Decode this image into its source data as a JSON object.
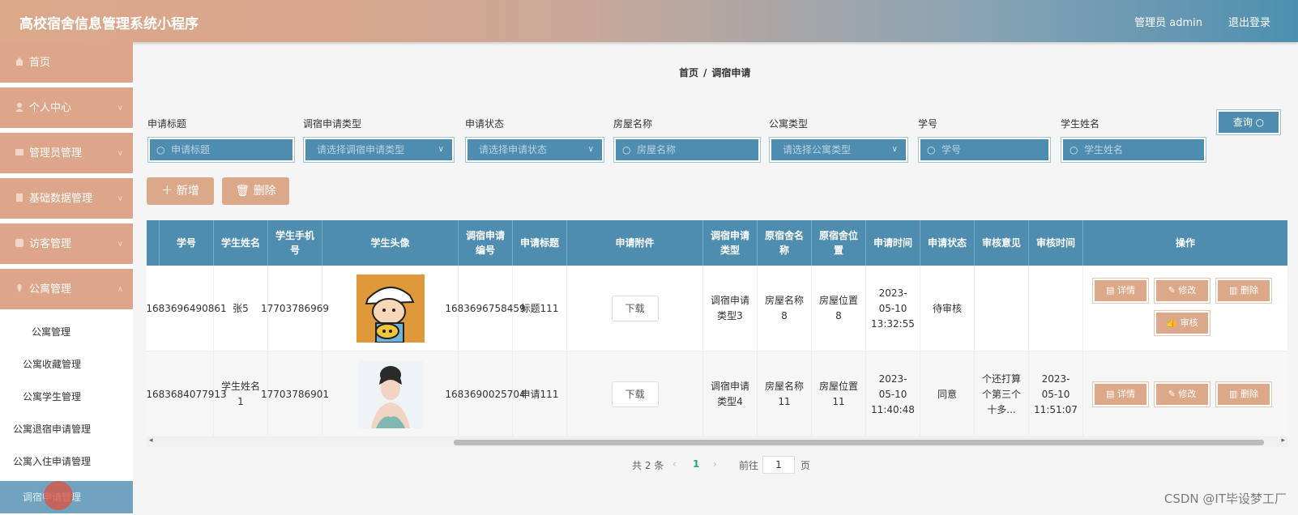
{
  "header": {
    "title": "高校宿舍信息管理系统小程序",
    "admin": "管理员 admin",
    "logout": "退出登录"
  },
  "sidebar": {
    "items": [
      {
        "label": "首页"
      },
      {
        "label": "个人中心"
      },
      {
        "label": "管理员管理"
      },
      {
        "label": "基础数据管理"
      },
      {
        "label": "访客管理"
      },
      {
        "label": "公寓管理"
      }
    ],
    "subitems": [
      {
        "label": "公寓管理"
      },
      {
        "label": "公寓收藏管理"
      },
      {
        "label": "公寓学生管理"
      },
      {
        "label": "公寓退宿申请管理"
      },
      {
        "label": "公寓入住申请管理"
      },
      {
        "label": "调宿申请管理"
      }
    ]
  },
  "breadcrumb": {
    "home": "首页",
    "sep": "/",
    "current": "调宿申请"
  },
  "filters": [
    {
      "label": "申请标题",
      "placeholder": "申请标题"
    },
    {
      "label": "调宿申请类型",
      "placeholder": "请选择调宿申请类型"
    },
    {
      "label": "申请状态",
      "placeholder": "请选择申请状态"
    },
    {
      "label": "房屋名称",
      "placeholder": "房屋名称"
    },
    {
      "label": "公寓类型",
      "placeholder": "请选择公寓类型"
    },
    {
      "label": "学号",
      "placeholder": "学号"
    },
    {
      "label": "学生姓名",
      "placeholder": "学生姓名"
    }
  ],
  "query_label": "查询",
  "actions": {
    "add": "新增",
    "delete": "删除"
  },
  "table": {
    "headers": [
      "学号",
      "学生姓名",
      "学生手机号",
      "学生头像",
      "调宿申请编号",
      "申请标题",
      "申请附件",
      "调宿申请类型",
      "原宿舍名称",
      "原宿舍位置",
      "申请时间",
      "申请状态",
      "审核意见",
      "审核时间",
      "操作"
    ],
    "rows": [
      {
        "id": "1683696490861",
        "name": "张5",
        "phone": "17703786969",
        "no": "1683696758459",
        "title": "标题111",
        "file": "下载",
        "type": "调宿申请类型3",
        "room": "房屋名称8",
        "pos": "房屋位置8",
        "time": "2023-05-10 13:32:55",
        "status": "待审核",
        "opinion": "",
        "review_time": ""
      },
      {
        "id": "1683684077913",
        "name": "学生姓名1",
        "phone": "17703786901",
        "no": "1683690025704",
        "title": "申请111",
        "file": "下载",
        "type": "调宿申请类型4",
        "room": "房屋名称11",
        "pos": "房屋位置11",
        "time": "2023-05-10 11:40:48",
        "status": "同意",
        "opinion": "个还打算个第三个十多...",
        "review_time": "2023-05-10 11:51:07"
      }
    ],
    "ops": {
      "detail": "详情",
      "edit": "修改",
      "delete": "删除",
      "review": "审核"
    }
  },
  "pagination": {
    "total": "共 2 条",
    "page": "1",
    "goto": "前往",
    "input": "1",
    "unit": "页"
  },
  "watermark": "CSDN @IT毕设梦工厂"
}
